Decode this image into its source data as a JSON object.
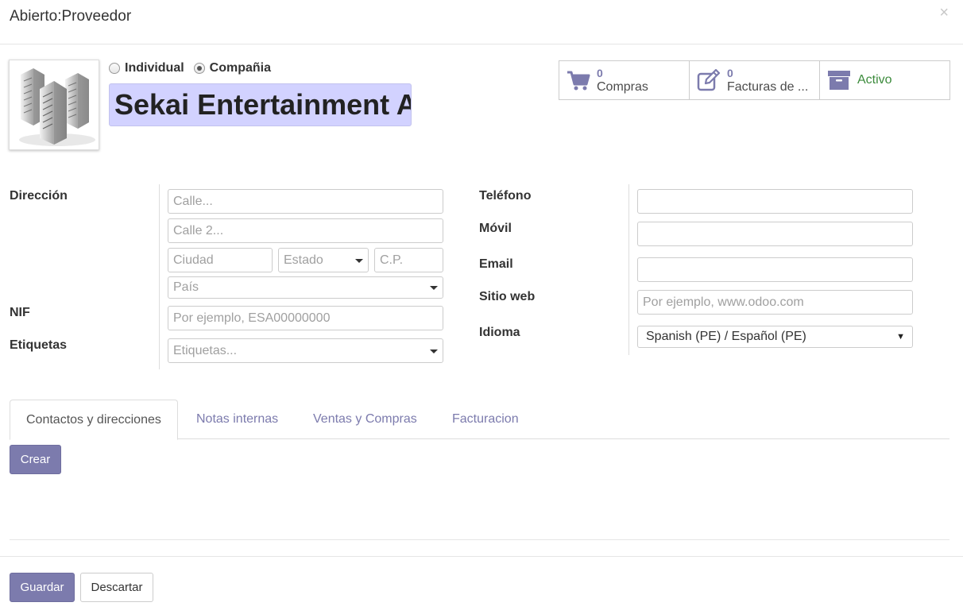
{
  "modal": {
    "title": "Abierto:Proveedor",
    "close": "×"
  },
  "partner": {
    "type_options": [
      {
        "label": "Individual",
        "checked": false
      },
      {
        "label": "Compañia",
        "checked": true
      }
    ],
    "name": "Sekai Entertainment AQ"
  },
  "smart_buttons": [
    {
      "icon": "shopping-cart-icon",
      "count": "0",
      "label": "Compras"
    },
    {
      "icon": "edit-invoice-icon",
      "count": "0",
      "label": "Facturas de ..."
    },
    {
      "icon": "archive-icon",
      "label": "Activo"
    }
  ],
  "left_form": {
    "direccion_label": "Dirección",
    "street_placeholder": "Calle...",
    "street2_placeholder": "Calle 2...",
    "city_placeholder": "Ciudad",
    "state_placeholder": "Estado",
    "zip_placeholder": "C.P.",
    "country_placeholder": "País",
    "nif_label": "NIF",
    "nif_placeholder": "Por ejemplo, ESA00000000",
    "tags_label": "Etiquetas",
    "tags_placeholder": "Etiquetas..."
  },
  "right_form": {
    "phone_label": "Teléfono",
    "mobile_label": "Móvil",
    "email_label": "Email",
    "website_label": "Sitio web",
    "website_placeholder": "Por ejemplo, www.odoo.com",
    "language_label": "Idioma",
    "language_value": "Spanish (PE) / Español (PE)"
  },
  "tabs": [
    {
      "label": "Contactos y direcciones",
      "active": true
    },
    {
      "label": "Notas internas",
      "active": false
    },
    {
      "label": "Ventas y Compras",
      "active": false
    },
    {
      "label": "Facturacion",
      "active": false
    }
  ],
  "tab_content": {
    "create_label": "Crear"
  },
  "footer": {
    "save_label": "Guardar",
    "discard_label": "Descartar"
  },
  "colors": {
    "accent": "#7c7bad",
    "name_bg": "#d2d2ff",
    "active_green": "#3c8b3c"
  }
}
